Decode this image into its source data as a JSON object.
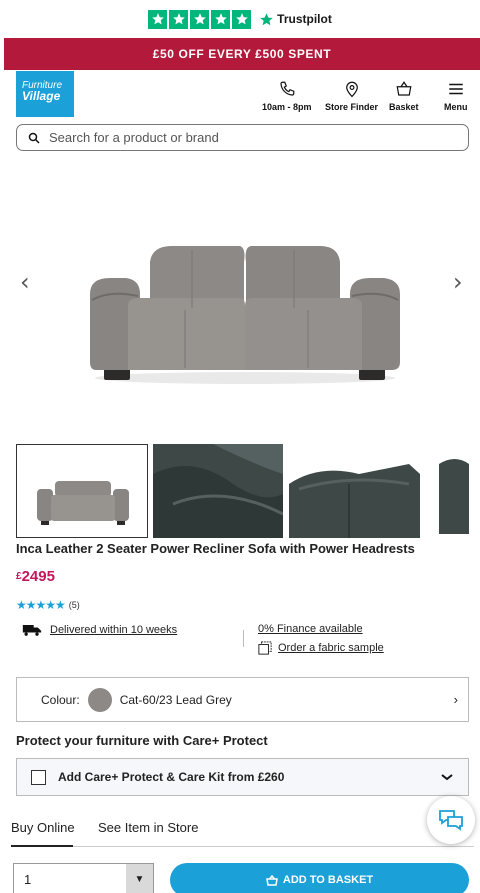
{
  "trustpilot": {
    "label": "Trustpilot",
    "rating_stars": 5
  },
  "promo": {
    "text": "£50 OFF EVERY £500 SPENT"
  },
  "brand": {
    "line1": "Furniture",
    "line2": "Village"
  },
  "header": {
    "hours_label": "10am - 8pm",
    "store_finder_label": "Store Finder",
    "basket_label": "Basket",
    "menu_label": "Menu"
  },
  "search": {
    "placeholder": "Search for a product or brand"
  },
  "gallery": {
    "prev_symbol": "‹",
    "next_symbol": "›",
    "thumbnail_count": 4,
    "selected_index": 0
  },
  "product": {
    "title": "Inca Leather 2 Seater Power Recliner Sofa with Power Headrests",
    "currency": "£",
    "price": "2495",
    "rating_stars": 5,
    "review_count": "(5)",
    "delivery": "Delivered within 10 weeks",
    "finance": "0% Finance available",
    "fabric_sample": "Order a fabric sample"
  },
  "colour": {
    "label": "Colour:",
    "value": "Cat-60/23 Lead Grey",
    "swatch": "#8d8987"
  },
  "care": {
    "title": "Protect your furniture with Care+ Protect",
    "option": "Add Care+ Protect & Care Kit from £260"
  },
  "tabs": [
    {
      "label": "Buy Online"
    },
    {
      "label": "See Item in Store"
    }
  ],
  "buy": {
    "quantity": "1",
    "add_label": "ADD TO BASKET"
  },
  "colors": {
    "accent": "#1ba0d8",
    "promo": "#b3193a",
    "price": "#c2185b",
    "trustpilot": "#00b67a"
  }
}
